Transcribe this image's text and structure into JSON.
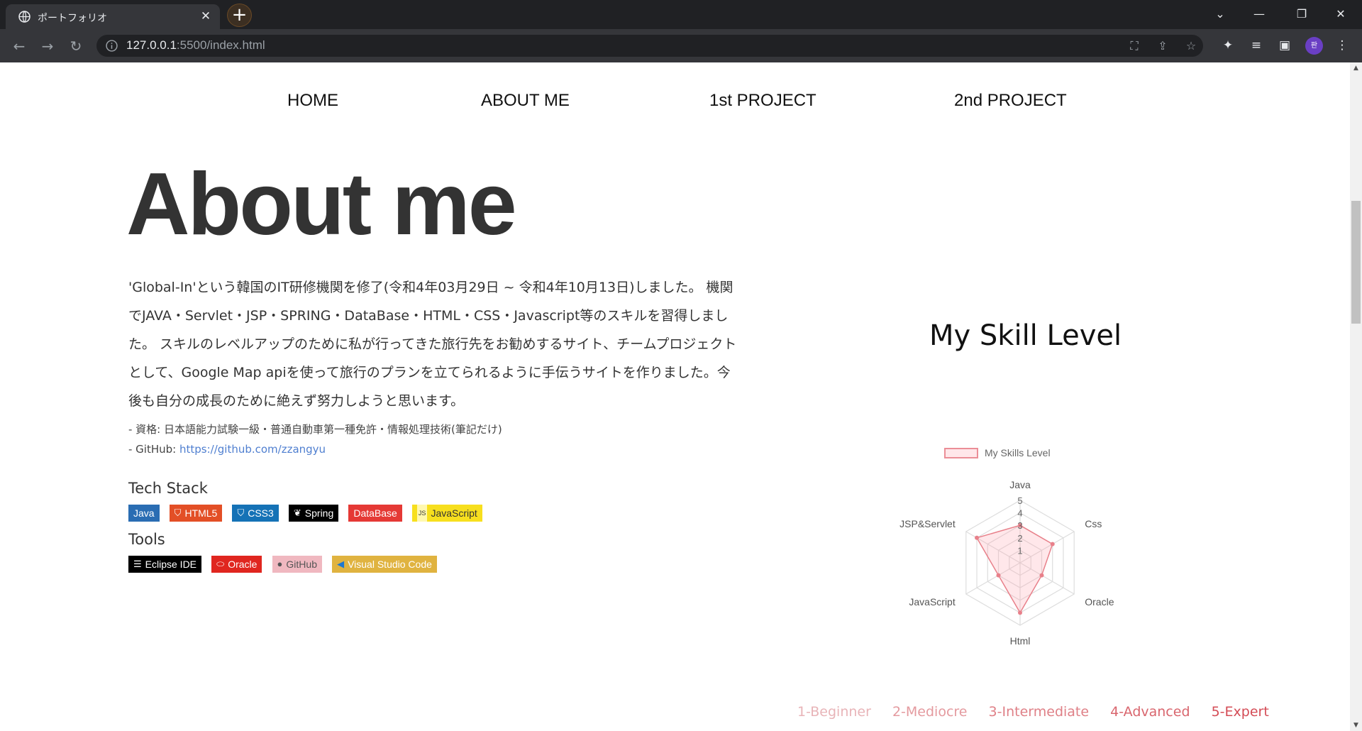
{
  "browser": {
    "tab_title": "ポートフォリオ",
    "url_host": "127.0.0.1",
    "url_rest": ":5500/index.html",
    "profile_initial": "판"
  },
  "nav": {
    "items": [
      "HOME",
      "ABOUT ME",
      "1st PROJECT",
      "2nd PROJECT"
    ]
  },
  "about": {
    "title": "About me",
    "intro": "'Global-In'という韓国のIT研修機関を修了(令和4年03月29日 ~ 令和4年10月13日)しました。 機関でJAVA・Servlet・JSP・SPRING・DataBase・HTML・CSS・Javascript等のスキルを習得しました。 スキルのレベルアップのために私が行ってきた旅行先をお勧めするサイト、チームプロジェクトとして、Google Map apiを使って旅行のプランを立てられるように手伝うサイトを作りました。今後も自分の成長のために絶えず努力しようと思います。",
    "qualification": "- 資格: 日本語能力試験一級・普通自動車第一種免許・情報処理技術(筆記だけ)",
    "github_prefix": "- GitHub: ",
    "github_url": "https://github.com/zzangyu"
  },
  "tech_stack": {
    "heading": "Tech Stack",
    "badges": [
      {
        "label": "Java",
        "icon": "java-icon",
        "color": "#2a6db3",
        "fg": "#ffffff"
      },
      {
        "label": "HTML5",
        "icon": "html5-icon",
        "color": "#e34f26",
        "fg": "#ffffff"
      },
      {
        "label": "CSS3",
        "icon": "css3-icon",
        "color": "#1572b6",
        "fg": "#ffffff"
      },
      {
        "label": "Spring",
        "icon": "spring-icon",
        "color": "#000000",
        "fg": "#ffffff"
      },
      {
        "label": "DataBase",
        "icon": "",
        "color": "#e53935",
        "fg": "#ffffff"
      },
      {
        "label": "JavaScript",
        "icon": "javascript-icon",
        "color": "#f7df1e",
        "fg": "#333333"
      }
    ]
  },
  "tools": {
    "heading": "Tools",
    "badges": [
      {
        "label": "Eclipse IDE",
        "icon": "eclipse-icon",
        "color": "#000000",
        "fg": "#ffffff"
      },
      {
        "label": "Oracle",
        "icon": "oracle-icon",
        "color": "#e0261f",
        "fg": "#ffffff"
      },
      {
        "label": "GitHub",
        "icon": "github-icon",
        "color": "#f0b8c0",
        "fg": "#555555"
      },
      {
        "label": "Visual Studio Code",
        "icon": "vscode-icon",
        "color": "#e0b340",
        "fg": "#ffffff"
      }
    ]
  },
  "skills": {
    "title": "My Skill Level",
    "levels": [
      {
        "label": "1-Beginner",
        "color": "#e8b4b8"
      },
      {
        "label": "2-Mediocre",
        "color": "#e49a9f"
      },
      {
        "label": "3-Intermediate",
        "color": "#df8087"
      },
      {
        "label": "4-Advanced",
        "color": "#d9666e"
      },
      {
        "label": "5-Expert",
        "color": "#d44c56"
      }
    ]
  },
  "chart_data": {
    "type": "radar",
    "categories": [
      "Java",
      "Css",
      "Oracle",
      "Html",
      "JavaScript",
      "JSP&Servlet"
    ],
    "series": [
      {
        "name": "My Skills Level",
        "values": [
          3,
          3,
          2,
          4,
          2,
          4
        ]
      }
    ],
    "rlim": [
      0,
      5
    ],
    "ticks": [
      "1",
      "2",
      "3",
      "4",
      "5"
    ],
    "legend_position": "top",
    "colors": {
      "fill": "rgba(255,160,170,0.25)",
      "line": "#e8808a",
      "grid": "#dddddd",
      "labels": "#555555"
    }
  }
}
